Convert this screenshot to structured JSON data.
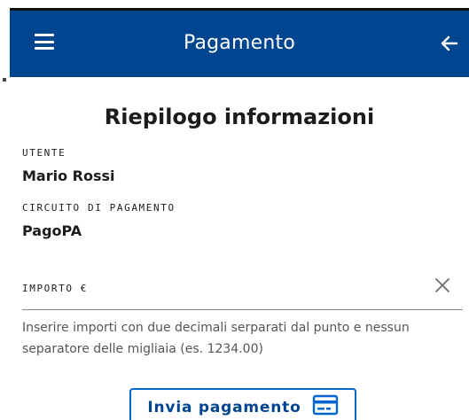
{
  "appbar": {
    "title": "Pagamento",
    "menu_icon": "hamburger-menu-icon",
    "back_icon": "arrow-left-icon",
    "color": "#00458f"
  },
  "summary": {
    "heading": "Riepilogo informazioni",
    "user_label": "UTENTE",
    "user_value": "Mario Rossi",
    "circuit_label": "CIRCUITO DI PAGAMENTO",
    "circuit_value": "PagoPA"
  },
  "amount": {
    "label": "IMPORTO €",
    "value": "",
    "clear_icon": "close-icon",
    "hint": "Inserire importi con due decimali serparati dal punto e nessun separatore delle migliaia (es. 1234.00)"
  },
  "actions": {
    "pay_label": "Invia pagamento",
    "pay_icon": "credit-card-icon",
    "accent": "#0066cc"
  }
}
